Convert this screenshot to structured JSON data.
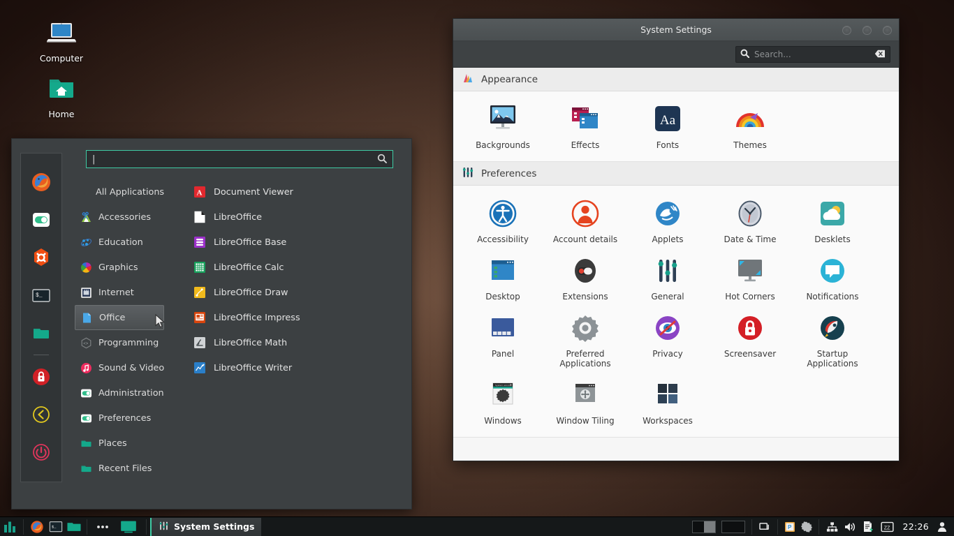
{
  "desktop": {
    "icons": [
      {
        "label": "Computer",
        "icon": "computer-icon"
      },
      {
        "label": "Home",
        "icon": "home-folder-icon"
      }
    ]
  },
  "menu": {
    "search": {
      "value": "",
      "placeholder": "",
      "icon": "search-icon"
    },
    "favorites": [
      {
        "name": "firefox-icon"
      },
      {
        "name": "settings-toggle-icon"
      },
      {
        "name": "software-manager-icon"
      },
      {
        "name": "terminal-icon"
      },
      {
        "name": "files-icon"
      },
      {
        "name": "lock-screen-icon"
      },
      {
        "name": "logout-icon"
      },
      {
        "name": "power-icon"
      }
    ],
    "categories": [
      {
        "label": "All Applications",
        "icon": "none",
        "selected": false
      },
      {
        "label": "Accessories",
        "icon": "accessories-icon",
        "selected": false
      },
      {
        "label": "Education",
        "icon": "education-icon",
        "selected": false
      },
      {
        "label": "Graphics",
        "icon": "graphics-icon",
        "selected": false
      },
      {
        "label": "Internet",
        "icon": "internet-icon",
        "selected": false
      },
      {
        "label": "Office",
        "icon": "office-icon",
        "selected": true
      },
      {
        "label": "Programming",
        "icon": "programming-icon",
        "selected": false
      },
      {
        "label": "Sound & Video",
        "icon": "sound-video-icon",
        "selected": false
      },
      {
        "label": "Administration",
        "icon": "administration-icon",
        "selected": false
      },
      {
        "label": "Preferences",
        "icon": "preferences-icon",
        "selected": false
      },
      {
        "label": "Places",
        "icon": "places-icon",
        "selected": false
      },
      {
        "label": "Recent Files",
        "icon": "recent-files-icon",
        "selected": false
      }
    ],
    "applications": [
      {
        "label": "Document Viewer",
        "icon": "pdf-icon"
      },
      {
        "label": "LibreOffice",
        "icon": "libreoffice-icon"
      },
      {
        "label": "LibreOffice Base",
        "icon": "libreoffice-base-icon"
      },
      {
        "label": "LibreOffice Calc",
        "icon": "libreoffice-calc-icon"
      },
      {
        "label": "LibreOffice Draw",
        "icon": "libreoffice-draw-icon"
      },
      {
        "label": "LibreOffice Impress",
        "icon": "libreoffice-impress-icon"
      },
      {
        "label": "LibreOffice Math",
        "icon": "libreoffice-math-icon"
      },
      {
        "label": "LibreOffice Writer",
        "icon": "libreoffice-writer-icon"
      }
    ]
  },
  "system_settings": {
    "title": "System Settings",
    "window_buttons": [
      "minimize",
      "maximize",
      "close"
    ],
    "search": {
      "value": "",
      "placeholder": "Search...",
      "icon": "search-icon",
      "clear_icon": "clear-icon"
    },
    "sections": [
      {
        "title": "Appearance",
        "icon": "appearance-icon",
        "tiles": [
          {
            "label": "Backgrounds",
            "icon": "backgrounds-icon"
          },
          {
            "label": "Effects",
            "icon": "effects-icon"
          },
          {
            "label": "Fonts",
            "icon": "fonts-icon"
          },
          {
            "label": "Themes",
            "icon": "themes-icon"
          }
        ]
      },
      {
        "title": "Preferences",
        "icon": "preferences-sliders-icon",
        "tiles": [
          {
            "label": "Accessibility",
            "icon": "accessibility-icon"
          },
          {
            "label": "Account details",
            "icon": "account-details-icon"
          },
          {
            "label": "Applets",
            "icon": "applets-icon"
          },
          {
            "label": "Date & Time",
            "icon": "date-time-icon"
          },
          {
            "label": "Desklets",
            "icon": "desklets-icon"
          },
          {
            "label": "Desktop",
            "icon": "desktop-icon"
          },
          {
            "label": "Extensions",
            "icon": "extensions-icon"
          },
          {
            "label": "General",
            "icon": "general-icon"
          },
          {
            "label": "Hot Corners",
            "icon": "hot-corners-icon"
          },
          {
            "label": "Notifications",
            "icon": "notifications-icon"
          },
          {
            "label": "Panel",
            "icon": "panel-icon"
          },
          {
            "label": "Preferred Applications",
            "icon": "preferred-applications-icon"
          },
          {
            "label": "Privacy",
            "icon": "privacy-icon"
          },
          {
            "label": "Screensaver",
            "icon": "screensaver-icon"
          },
          {
            "label": "Startup Applications",
            "icon": "startup-applications-icon"
          },
          {
            "label": "Windows",
            "icon": "windows-icon"
          },
          {
            "label": "Window Tiling",
            "icon": "window-tiling-icon"
          },
          {
            "label": "Workspaces",
            "icon": "workspaces-icon"
          }
        ]
      }
    ]
  },
  "taskbar": {
    "menu_button": "menu-icon",
    "launchers": [
      {
        "name": "firefox-icon"
      },
      {
        "name": "terminal-icon"
      },
      {
        "name": "files-icon"
      }
    ],
    "show_desktop": "show-desktop-icon",
    "overflow": "overflow-icon",
    "window_title": "System Settings",
    "window_icon": "system-settings-icon",
    "tray": [
      {
        "name": "workspace-switcher"
      },
      {
        "name": "window-list-icon"
      },
      {
        "name": "clipboard-icon"
      },
      {
        "name": "updates-icon"
      },
      {
        "name": "network-icon"
      },
      {
        "name": "volume-icon"
      },
      {
        "name": "printer-icon"
      },
      {
        "name": "notes-icon"
      }
    ],
    "clock": "22:26",
    "user_icon": "user-icon"
  },
  "colors": {
    "accent": "#3fcba4",
    "panel_bg": "#151819",
    "menu_bg": "#3c4042",
    "settings_bg": "#f6f6f6",
    "titlebar": "#4a4f51"
  }
}
